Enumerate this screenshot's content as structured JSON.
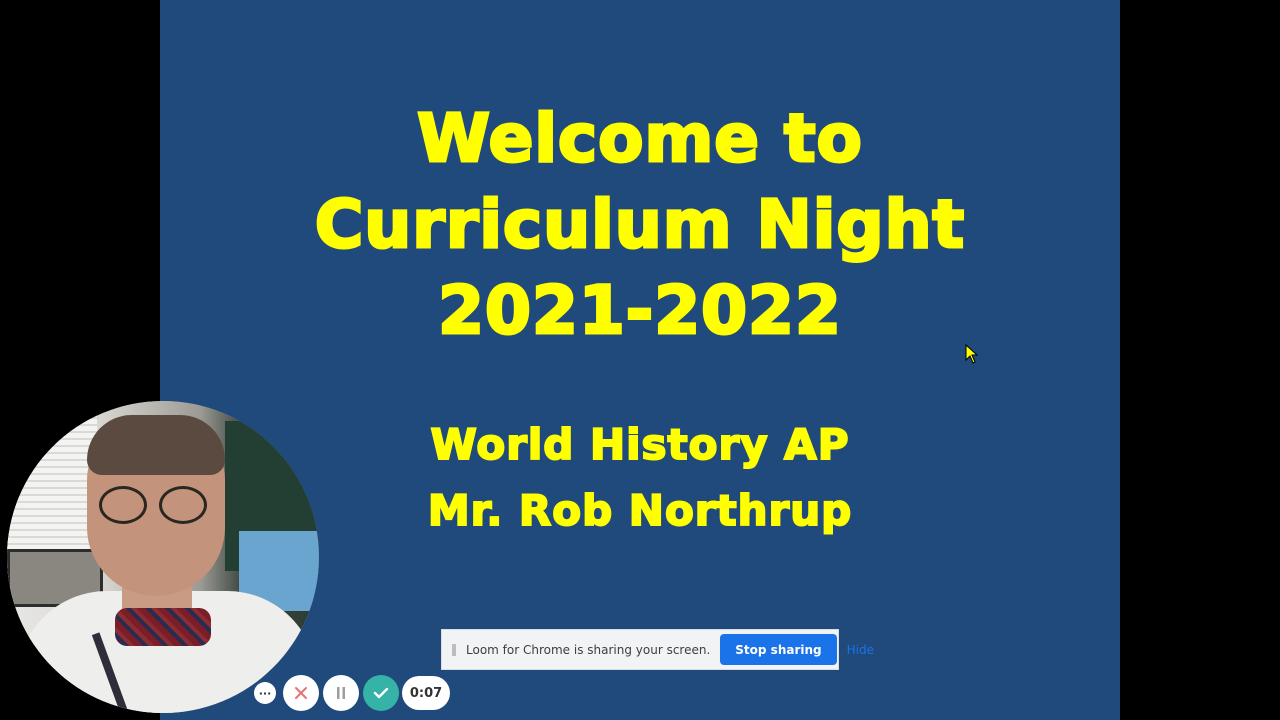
{
  "slide": {
    "title_lines": [
      "Welcome to",
      "Curriculum Night",
      "2021-2022"
    ],
    "subtitle_lines": [
      "World History AP",
      "Mr. Rob Northrup"
    ],
    "background_color": "#1f4a7b",
    "text_color": "#ffff00"
  },
  "recorder": {
    "more_label": "···",
    "timer": "0:07",
    "icons": [
      "more-icon",
      "close-icon",
      "pause-icon",
      "check-icon"
    ]
  },
  "share_bar": {
    "message": "Loom for Chrome is sharing your screen.",
    "stop_label": "Stop sharing",
    "hide_label": "Hide"
  }
}
